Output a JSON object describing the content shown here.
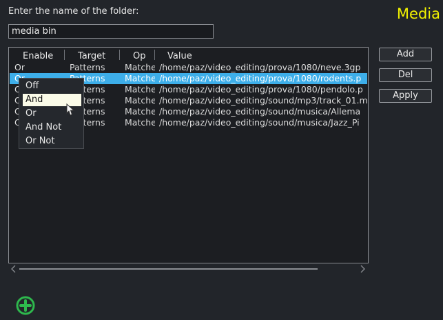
{
  "dialog": {
    "prompt": "Enter the name of the folder:",
    "title": "Media",
    "folder_name": "media bin"
  },
  "buttons": {
    "add": "Add",
    "del": "Del",
    "apply": "Apply"
  },
  "table": {
    "columns": [
      "Enable",
      "Target",
      "Op",
      "Value"
    ],
    "rows": [
      {
        "enable": "Or",
        "target": "Patterns",
        "op": "Matches",
        "value": "/home/paz/video_editing/prova/1080/neve.3gp"
      },
      {
        "enable": "Or",
        "target": "Patterns",
        "op": "Matches",
        "value": "/home/paz/video_editing/prova/1080/rodents.p"
      },
      {
        "enable": "Or",
        "target": "Patterns",
        "op": "Matches",
        "value": "/home/paz/video_editing/prova/1080/pendolo.p"
      },
      {
        "enable": "Or",
        "target": "Patterns",
        "op": "Matches",
        "value": "/home/paz/video_editing/sound/mp3/track_01.m"
      },
      {
        "enable": "Or",
        "target": "Patterns",
        "op": "Matches",
        "value": "/home/paz/video_editing/sound/musica/Allema"
      },
      {
        "enable": "Or",
        "target": "Patterns",
        "op": "Matches",
        "value": "/home/paz/video_editing/sound/musica/Jazz_Pi"
      }
    ],
    "selected_row": 1
  },
  "context_menu": {
    "items": [
      "Off",
      "And",
      "Or",
      "And Not",
      "Or Not"
    ],
    "highlighted": "And"
  },
  "icons": {
    "add": "plus-circle-icon",
    "scroll_left": "chevron-left-icon",
    "scroll_right": "chevron-right-icon",
    "cursor": "mouse-pointer-icon"
  },
  "colors": {
    "title": "#f2f200",
    "selection": "#3daee9",
    "add_icon": "#2eb84d"
  }
}
